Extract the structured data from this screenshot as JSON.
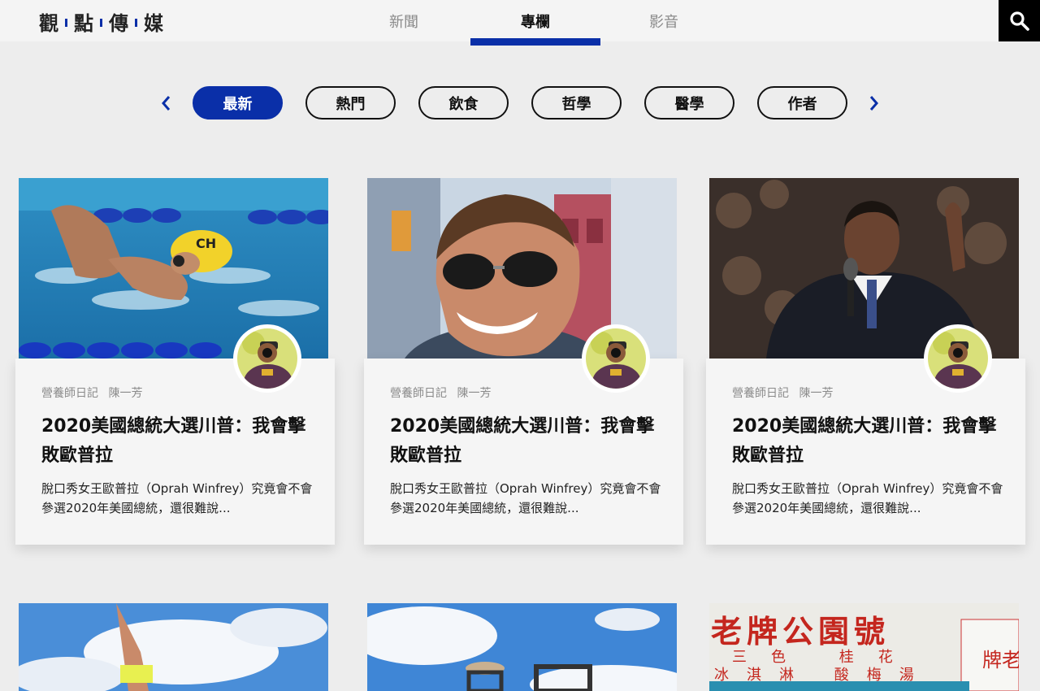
{
  "header": {
    "logo_chars": [
      "觀",
      "點",
      "傳",
      "媒"
    ],
    "tabs": [
      {
        "label": "新聞"
      },
      {
        "label": "專欄"
      },
      {
        "label": "影音"
      }
    ]
  },
  "categories": [
    {
      "label": "最新"
    },
    {
      "label": "熱門"
    },
    {
      "label": "飲食"
    },
    {
      "label": "哲學"
    },
    {
      "label": "醫學"
    },
    {
      "label": "作者"
    }
  ],
  "cards": [
    {
      "column": "營養師日記",
      "author": "陳一芳",
      "title": "2020美國總統大選川普：我會擊敗歐普拉",
      "excerpt": "脫口秀女王歐普拉（Oprah Winfrey）究竟會不會參選2020年美國總統，還很難說..."
    },
    {
      "column": "營養師日記",
      "author": "陳一芳",
      "title": "2020美國總統大選川普：我會擊敗歐普拉",
      "excerpt": "脫口秀女王歐普拉（Oprah Winfrey）究竟會不會參選2020年美國總統，還很難說..."
    },
    {
      "column": "營養師日記",
      "author": "陳一芳",
      "title": "2020美國總統大選川普：我會擊敗歐普拉",
      "excerpt": "脫口秀女王歐普拉（Oprah Winfrey）究竟會不會參選2020年美國總統，還很難說..."
    }
  ],
  "bottom_sign": {
    "line1": "老牌公園號",
    "line2": "三色 桂花",
    "line3": "冰淇淋 酸梅湯",
    "side": "牌老"
  },
  "colors": {
    "accent": "#0a2fa8",
    "background": "#ededed",
    "card": "#f5f5f5"
  }
}
